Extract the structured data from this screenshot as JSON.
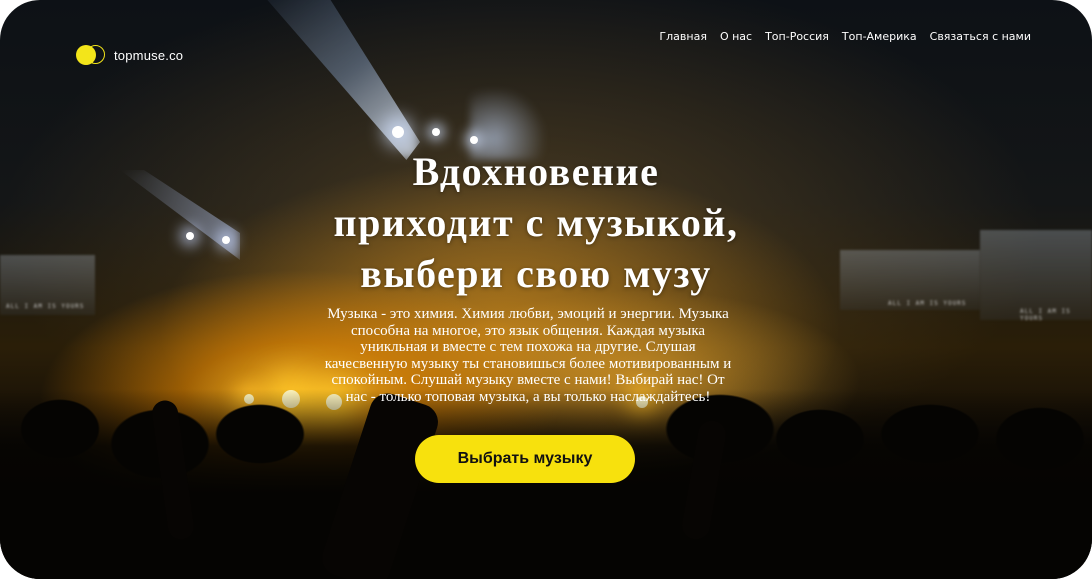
{
  "brand": {
    "name": "topmuse.co",
    "logo_icon": "double-circle-logo",
    "accent_color": "#f3e51a"
  },
  "nav": {
    "items": [
      {
        "label": "Главная"
      },
      {
        "label": "О нас"
      },
      {
        "label": "Топ-Россия"
      },
      {
        "label": "Топ-Америка"
      },
      {
        "label": "Связаться с нами"
      }
    ]
  },
  "hero": {
    "title_lines": [
      "Вдохновение",
      "приходит с музыкой,",
      "выбери свою музу"
    ],
    "text": "Музыка - это химия. Химия любви, эмоций и энергии. Музыка способна на многое, это язык общения. Каждая музыка уникльная и вместе с тем похожа на другие. Слушая качесвенную музыку ты становишься более мотивированным и спокойным. Слушай музыку вместе с нами! Выбирай нас! От нас - только топовая музыка, а вы только наслаждайтесь!",
    "cta_label": "Выбрать музыку",
    "cta_color": "#f7e10d"
  },
  "background": {
    "screen_caption": "ALL I AM IS YOURS"
  }
}
